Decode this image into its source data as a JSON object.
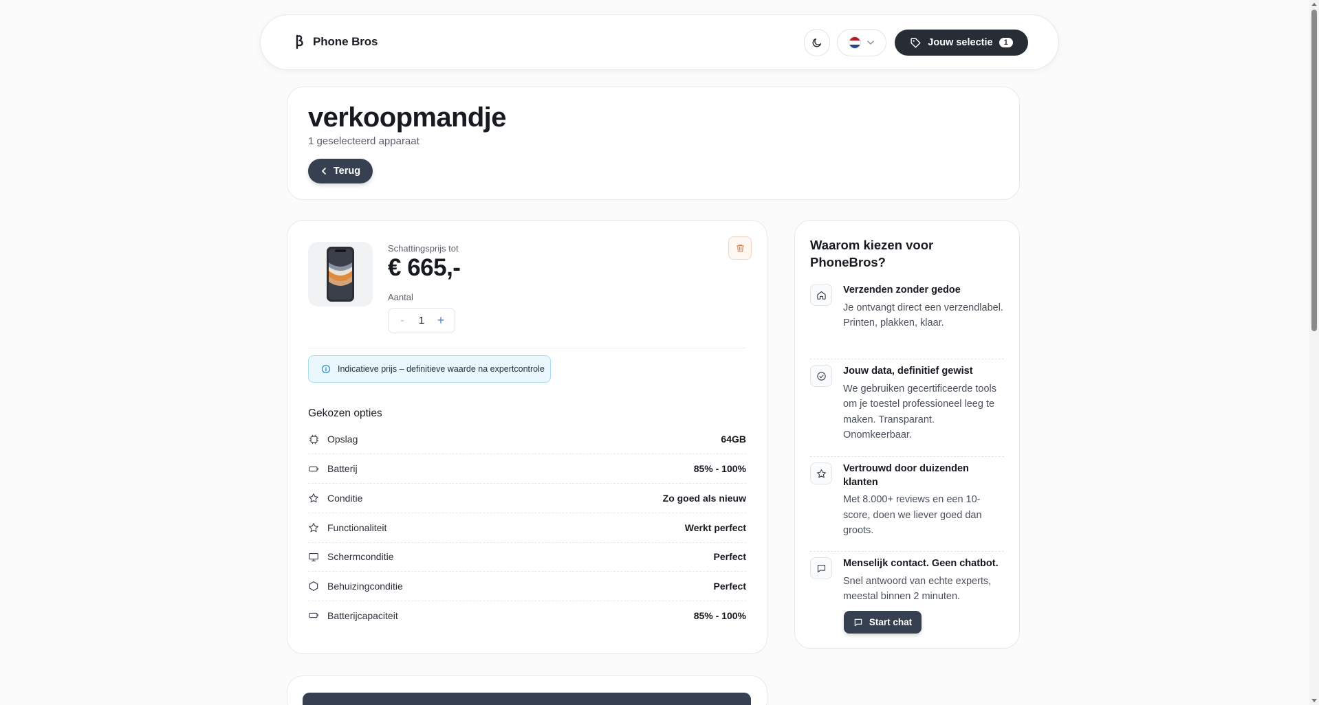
{
  "header": {
    "brand_name": "Phone Bros",
    "selection_label": "Jouw selectie",
    "selection_count": "1",
    "icons": {
      "logo": "brand-logo-icon",
      "theme": "moon-icon",
      "language": "flag-nl-icon",
      "dropdown": "chevron-down-icon",
      "selection": "tag-icon"
    }
  },
  "title_card": {
    "title": "verkoopmandje",
    "subtitle": "1 geselecteerd apparaat",
    "back_label": "Terug"
  },
  "product": {
    "estimate_label": "Schattingsprijs tot",
    "estimate_price": "€ 665,-",
    "quantity_label": "Aantal",
    "quantity_minus": "-",
    "quantity_value": "1",
    "quantity_plus": "+",
    "info_text": "Indicatieve prijs – definitieve waarde na expertcontrole",
    "options_heading": "Gekozen opties",
    "options": [
      {
        "label": "Opslag",
        "value": "64GB",
        "icon": "chip-icon"
      },
      {
        "label": "Batterij",
        "value": "85% - 100%",
        "icon": "battery-icon"
      },
      {
        "label": "Conditie",
        "value": "Zo goed als nieuw",
        "icon": "star-icon"
      },
      {
        "label": "Functionaliteit",
        "value": "Werkt perfect",
        "icon": "star-icon"
      },
      {
        "label": "Schermconditie",
        "value": "Perfect",
        "icon": "monitor-icon"
      },
      {
        "label": "Behuizingconditie",
        "value": "Perfect",
        "icon": "hexagon-icon"
      },
      {
        "label": "Batterijcapaciteit",
        "value": "85% - 100%",
        "icon": "battery-icon"
      }
    ]
  },
  "why": {
    "title": "Waarom kiezen voor PhoneBros?",
    "items": [
      {
        "heading": "Verzenden zonder gedoe",
        "text": "Je ontvangt direct een verzendlabel. Printen, plakken, klaar.",
        "icon": "home-icon"
      },
      {
        "heading": "Jouw data, definitief gewist",
        "text": "We gebruiken gecertificeerde tools om je toestel professioneel leeg te maken. Transparant. Onomkeerbaar.",
        "icon": "check-circle-icon"
      },
      {
        "heading": "Vertrouwd door duizenden klanten",
        "text": "Met 8.000+ reviews en een 10-score, doen we liever goed dan groots.",
        "icon": "star-icon"
      },
      {
        "heading": "Menselijk contact. Geen chatbot.",
        "text": "Snel antwoord van echte experts, meestal binnen 2 minuten.",
        "icon": "chat-icon"
      }
    ],
    "chat_label": "Start chat"
  },
  "colors": {
    "dark_button": "#374050",
    "primary_dark": "#272c35",
    "accent_blue": "#3f7fd8",
    "info_bg": "#eaf7fc"
  }
}
